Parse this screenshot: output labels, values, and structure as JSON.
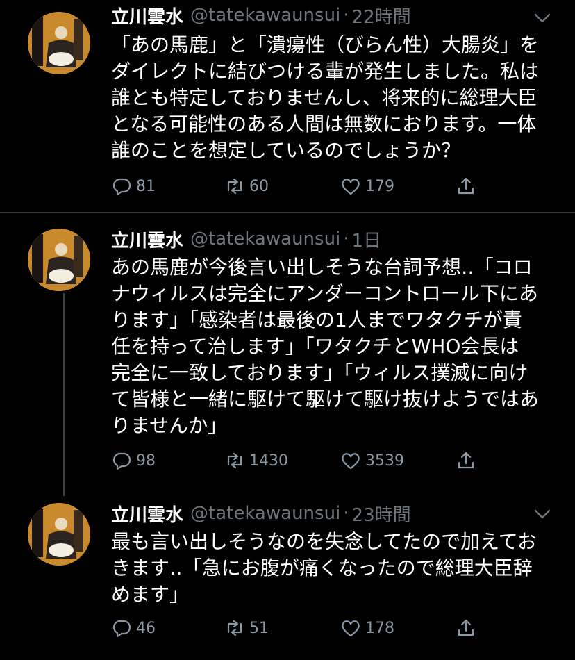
{
  "tweets": [
    {
      "name": "立川雲水",
      "handle": "@tatekawaunsui",
      "separator": "·",
      "time": "22時間",
      "text": "「あの馬鹿」と「潰瘍性（びらん性）大腸炎」を\nダイレクトに結びつける輩が発生しました。私は\n誰とも特定しておりませんし、将来的に総理大臣\nとなる可能性のある人間は無数におります。一体\n誰のことを想定しているのでしょうか？",
      "replies": "81",
      "retweets": "60",
      "likes": "179"
    },
    {
      "name": "立川雲水",
      "handle": "@tatekawaunsui",
      "separator": "·",
      "time": "1日",
      "text": "あの馬鹿が今後言い出しそうな台詞予想‥「コロ\nナウィルスは完全にアンダーコントロール下にあ\nります」「感染者は最後の1人までワタクチが責\n任を持って治します」「ワタクチとWHO会長は\n完全に一致しております」「ウィルス撲滅に向け\nて皆様と一緒に駆けて駆けて駆け抜けようではあ\nりませんか」",
      "replies": "98",
      "retweets": "1430",
      "likes": "3539"
    },
    {
      "name": "立川雲水",
      "handle": "@tatekawaunsui",
      "separator": "·",
      "time": "23時間",
      "text": "最も言い出しそうなのを失念してたので加えてお\nきます‥「急にお腹が痛くなったので総理大臣辞\nめます」",
      "replies": "46",
      "retweets": "51",
      "likes": "178"
    }
  ],
  "icons": {
    "reply": "reply-icon",
    "retweet": "retweet-icon",
    "like": "like-icon",
    "share": "share-icon",
    "more": "chevron-down-icon"
  },
  "colors": {
    "background": "#000000",
    "text": "#ffffff",
    "secondary": "#6e767d",
    "divider": "#2f3336"
  }
}
